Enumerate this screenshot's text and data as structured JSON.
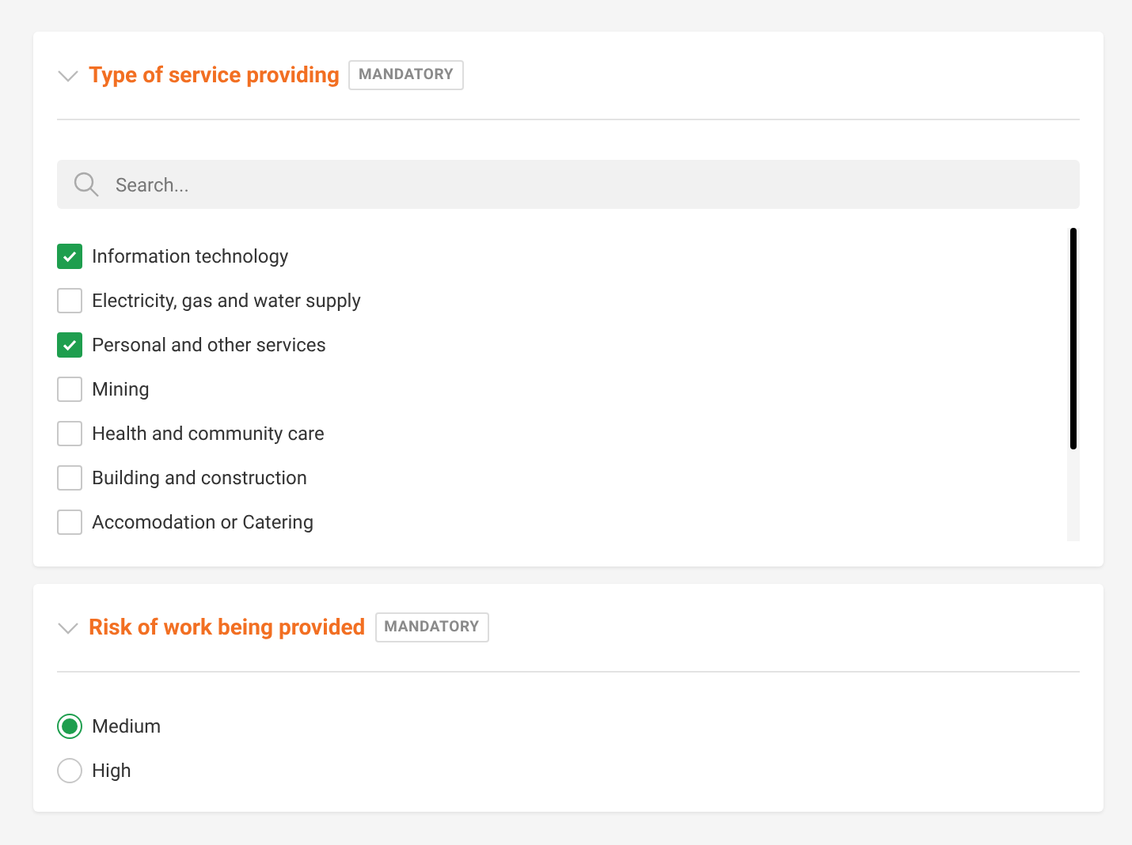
{
  "sections": [
    {
      "kind": "checklist",
      "title": "Type of service providing",
      "badge": "MANDATORY",
      "expanded": true,
      "search": {
        "placeholder": "Search..."
      },
      "options": [
        {
          "label": "Information technology",
          "checked": true
        },
        {
          "label": "Electricity, gas and water supply",
          "checked": false
        },
        {
          "label": "Personal and other services",
          "checked": true
        },
        {
          "label": "Mining",
          "checked": false
        },
        {
          "label": "Health and community care",
          "checked": false
        },
        {
          "label": "Building and construction",
          "checked": false
        },
        {
          "label": "Accomodation or Catering",
          "checked": false
        }
      ]
    },
    {
      "kind": "radio",
      "title": "Risk of work being provided",
      "badge": "MANDATORY",
      "expanded": true,
      "options": [
        {
          "label": "Medium",
          "selected": true
        },
        {
          "label": "High",
          "selected": false
        }
      ]
    }
  ]
}
